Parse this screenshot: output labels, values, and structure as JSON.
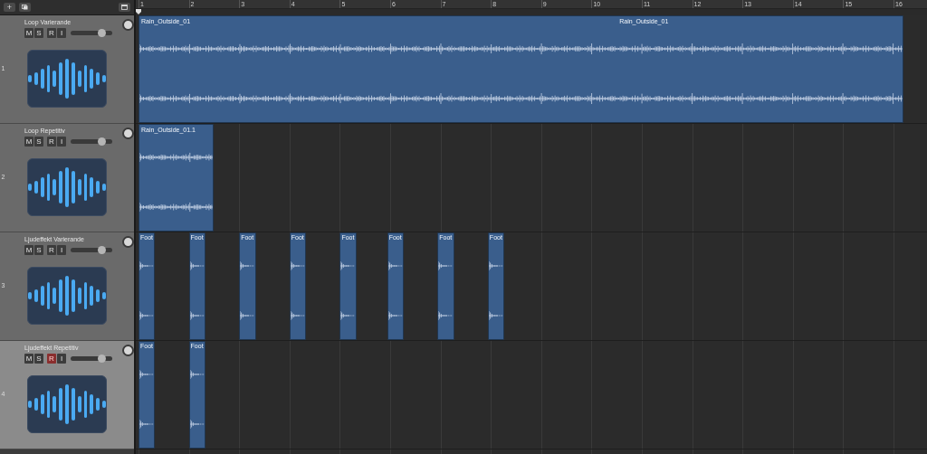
{
  "toolbar": {
    "add_label": "+"
  },
  "ruler": {
    "bars": [
      "1",
      "2",
      "3",
      "4",
      "5",
      "6",
      "7",
      "8",
      "9",
      "10",
      "11",
      "12",
      "13",
      "14",
      "15",
      "16"
    ]
  },
  "tracks": [
    {
      "number": "1",
      "name": "Loop Varierande",
      "selected": false,
      "mute": "M",
      "solo": "S",
      "record": "R",
      "input": "I",
      "record_enabled": false,
      "volume": {
        "level": 0.75
      },
      "regions": [
        {
          "kind": "loop",
          "labels": [
            "Rain_Outside_01",
            "Rain_Outside_01"
          ]
        }
      ]
    },
    {
      "number": "2",
      "name": "Loop Repetitiv",
      "selected": false,
      "mute": "M",
      "solo": "S",
      "record": "R",
      "input": "I",
      "record_enabled": false,
      "volume": {
        "level": 0.75
      },
      "regions": [
        {
          "kind": "loop",
          "labels": [
            "Rain_Outside_01.1"
          ]
        }
      ]
    },
    {
      "number": "3",
      "name": "Ljudeffekt Varierande",
      "selected": false,
      "mute": "M",
      "solo": "S",
      "record": "R",
      "input": "I",
      "record_enabled": false,
      "volume": {
        "level": 0.75
      },
      "regions": [
        {
          "kind": "hit",
          "labels": [
            "Foot"
          ]
        },
        {
          "kind": "hit",
          "labels": [
            "Foot"
          ]
        },
        {
          "kind": "hit",
          "labels": [
            "Foot"
          ]
        },
        {
          "kind": "hit",
          "labels": [
            "Foot"
          ]
        },
        {
          "kind": "hit",
          "labels": [
            "Foot"
          ]
        },
        {
          "kind": "hit",
          "labels": [
            "Foot"
          ]
        },
        {
          "kind": "hit",
          "labels": [
            "Foot"
          ]
        },
        {
          "kind": "hit",
          "labels": [
            "Foot"
          ]
        }
      ]
    },
    {
      "number": "4",
      "name": "Ljudeffekt Repetitiv",
      "selected": true,
      "mute": "M",
      "solo": "S",
      "record": "R",
      "input": "I",
      "record_enabled": true,
      "volume": {
        "level": 0.75
      },
      "regions": [
        {
          "kind": "hit",
          "labels": [
            "Foot"
          ]
        },
        {
          "kind": "hit",
          "labels": [
            "Foot"
          ]
        }
      ]
    }
  ]
}
